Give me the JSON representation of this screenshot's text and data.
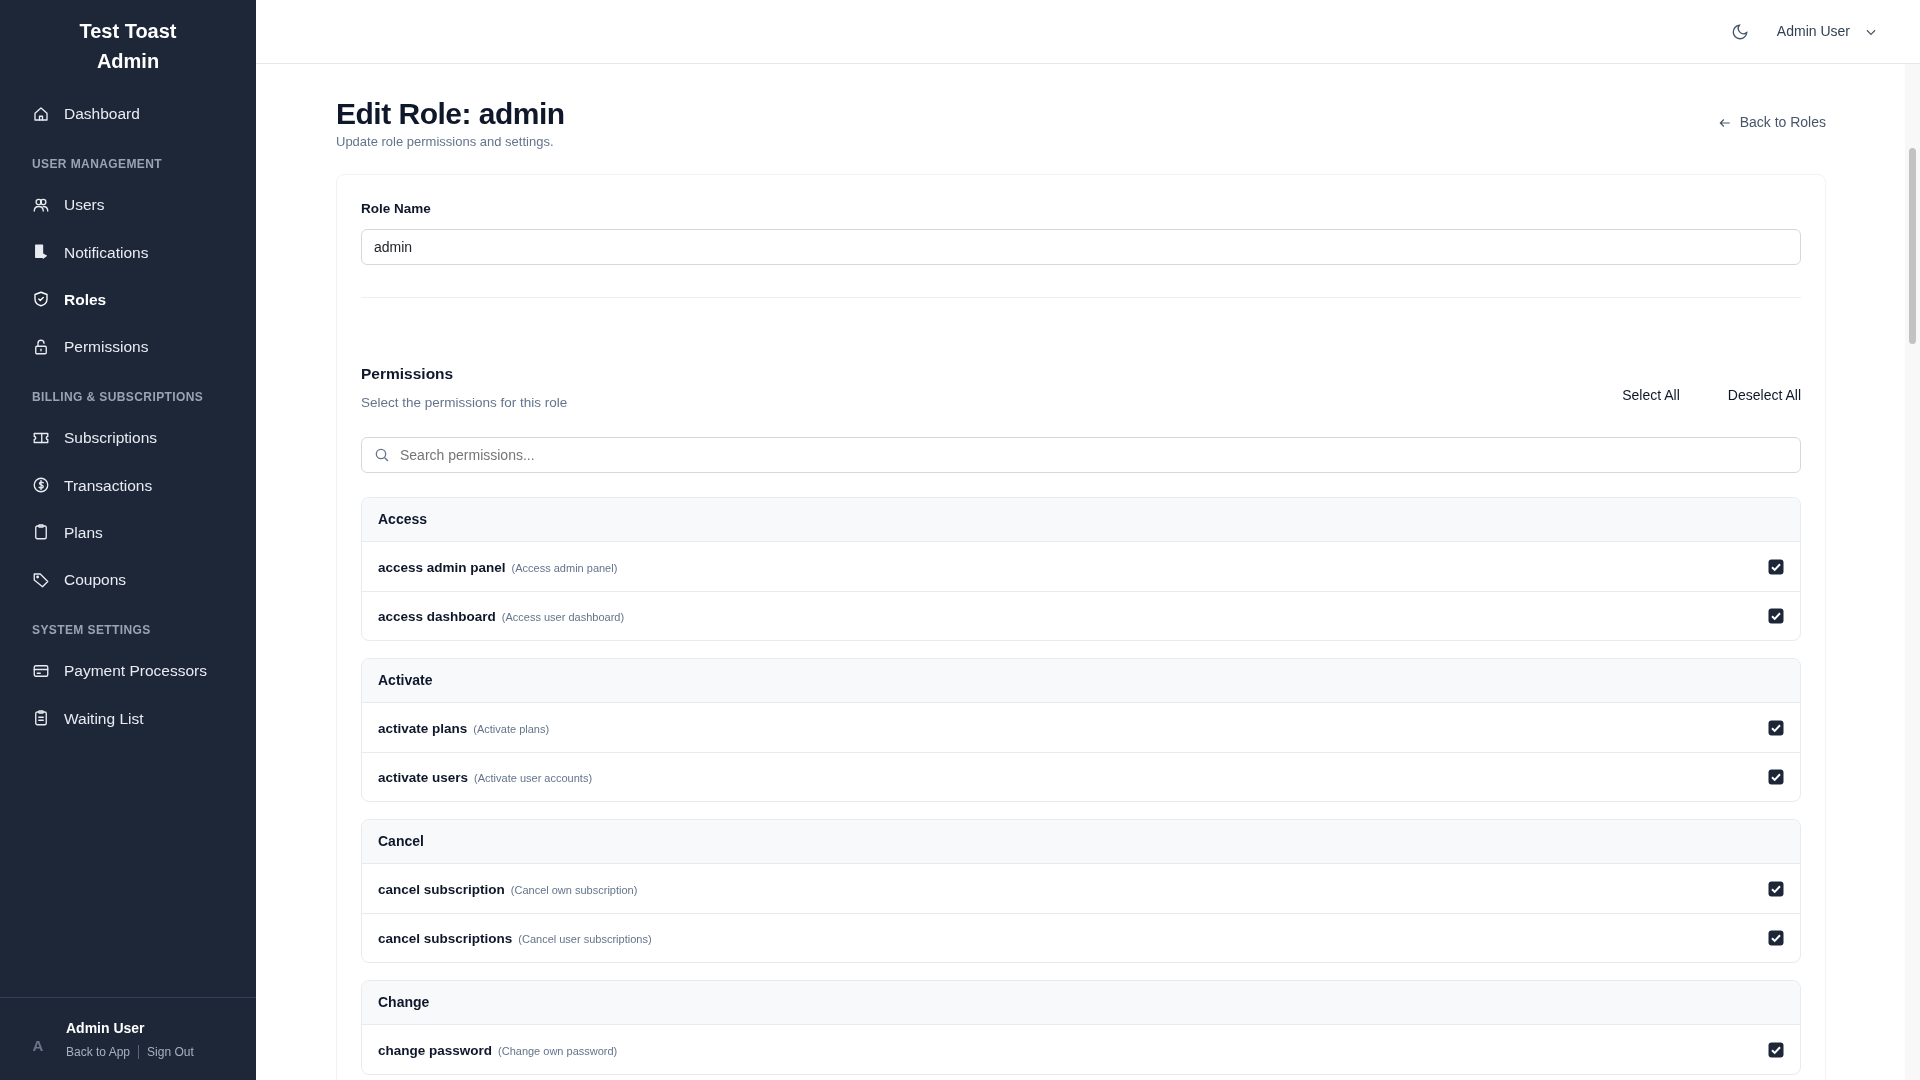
{
  "sidebar": {
    "brand": "Test Toast Admin",
    "sections": [
      {
        "items": [
          {
            "label": "Dashboard",
            "selected": false
          }
        ]
      },
      {
        "heading": "USER MANAGEMENT",
        "items": [
          {
            "label": "Users",
            "selected": false
          },
          {
            "label": "Notifications",
            "selected": false
          },
          {
            "label": "Roles",
            "selected": true
          },
          {
            "label": "Permissions",
            "selected": false
          }
        ]
      },
      {
        "heading": "BILLING & SUBSCRIPTIONS",
        "items": [
          {
            "label": "Subscriptions",
            "selected": false
          },
          {
            "label": "Transactions",
            "selected": false
          },
          {
            "label": "Plans",
            "selected": false
          },
          {
            "label": "Coupons",
            "selected": false
          }
        ]
      },
      {
        "heading": "SYSTEM SETTINGS",
        "items": [
          {
            "label": "Payment Processors",
            "selected": false
          },
          {
            "label": "Waiting List",
            "selected": false
          }
        ]
      }
    ],
    "footer": {
      "avatar": "A",
      "user": "Admin User",
      "links": [
        "Back to App",
        "Sign Out"
      ]
    }
  },
  "topbar": {
    "user": "Admin User"
  },
  "page": {
    "title": "Edit Role: admin",
    "subtitle": "Update role permissions and settings.",
    "back_link": "Back to Roles"
  },
  "form": {
    "role_name_label": "Role Name",
    "role_name_value": "admin",
    "permissions_title": "Permissions",
    "permissions_subtitle": "Select the permissions for this role",
    "select_all": "Select All",
    "deselect_all": "Deselect All",
    "search_placeholder": "Search permissions...",
    "groups": [
      {
        "name": "Access",
        "items": [
          {
            "name": "access admin panel",
            "description": "(Access admin panel)",
            "checked": true
          },
          {
            "name": "access dashboard",
            "description": "(Access user dashboard)",
            "checked": true
          }
        ]
      },
      {
        "name": "Activate",
        "items": [
          {
            "name": "activate plans",
            "description": "(Activate plans)",
            "checked": true
          },
          {
            "name": "activate users",
            "description": "(Activate user accounts)",
            "checked": true
          }
        ]
      },
      {
        "name": "Cancel",
        "items": [
          {
            "name": "cancel subscription",
            "description": "(Cancel own subscription)",
            "checked": true
          },
          {
            "name": "cancel subscriptions",
            "description": "(Cancel user subscriptions)",
            "checked": true
          }
        ]
      },
      {
        "name": "Change",
        "items": [
          {
            "name": "change password",
            "description": "(Change own password)",
            "checked": true
          }
        ]
      }
    ]
  }
}
